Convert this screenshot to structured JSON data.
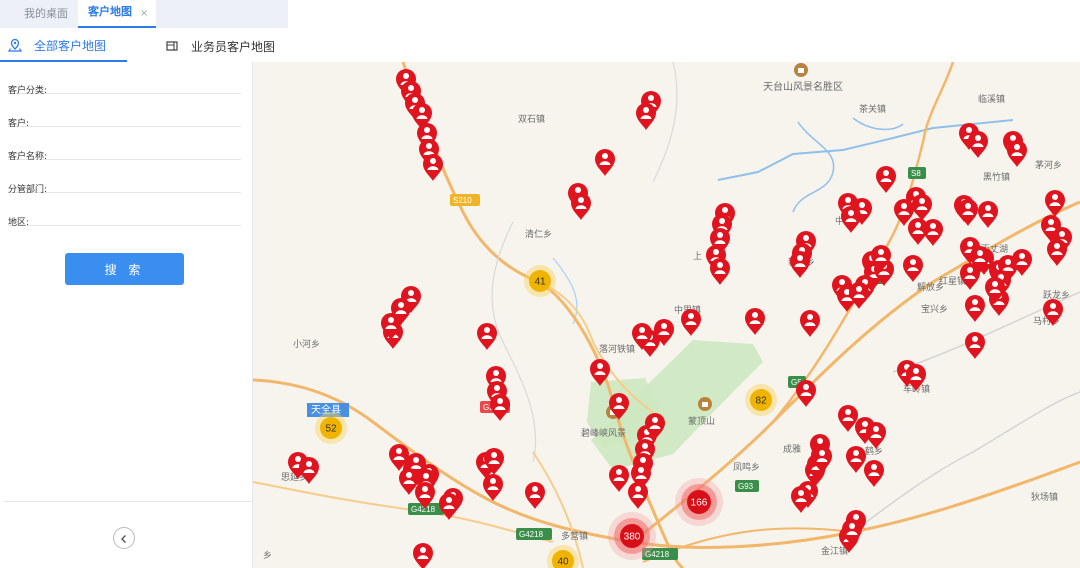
{
  "tabs": [
    {
      "label": "我的桌面"
    },
    {
      "label": "客户地图",
      "close": "×"
    }
  ],
  "subtabs": [
    {
      "label": "全部客户地图"
    },
    {
      "label": "业务员客户地图"
    }
  ],
  "filters": [
    {
      "label": "客户分类:"
    },
    {
      "label": "客户:"
    },
    {
      "label": "客户名称:"
    },
    {
      "label": "分管部门:"
    },
    {
      "label": "地区:"
    }
  ],
  "search_label": "搜 索",
  "map": {
    "places": [
      {
        "t": "天台山风景名胜区"
      },
      {
        "t": "双石镇"
      },
      {
        "t": "清仁乡"
      },
      {
        "t": "小河乡"
      },
      {
        "t": "上"
      },
      {
        "t": "中里镇"
      },
      {
        "t": "中峰"
      },
      {
        "t": "新县乡"
      },
      {
        "t": "落河铁镇"
      },
      {
        "t": "蒙顶山"
      },
      {
        "t": "碧峰峡风景"
      },
      {
        "t": "凤鸣乡"
      },
      {
        "t": "多营镇"
      },
      {
        "t": "金江镇"
      },
      {
        "t": "狄场镇"
      },
      {
        "t": "思延乡"
      },
      {
        "t": "鹤乡"
      },
      {
        "t": "红星镇"
      },
      {
        "t": "黑竹镇"
      },
      {
        "t": "茅河乡"
      },
      {
        "t": "马村乡"
      },
      {
        "t": "跃龙乡"
      },
      {
        "t": "解放乡"
      },
      {
        "t": "车岭镇"
      },
      {
        "t": "成雅"
      },
      {
        "t": "百丈湖"
      },
      {
        "t": "茶关镇"
      },
      {
        "t": "临溪镇"
      },
      {
        "t": "乡"
      },
      {
        "t": "天全县"
      },
      {
        "t": "宝兴乡"
      }
    ],
    "roads": [
      {
        "t": "S210"
      },
      {
        "t": "S8"
      },
      {
        "t": "G5"
      },
      {
        "t": "G5"
      },
      {
        "t": "G4218"
      },
      {
        "t": "G4218"
      },
      {
        "t": "G4218"
      },
      {
        "t": "G93"
      },
      {
        "t": "G351"
      }
    ],
    "clusters": [
      {
        "n": "41",
        "kind": "yellow"
      },
      {
        "n": "52",
        "kind": "yellow"
      },
      {
        "n": "82",
        "kind": "yellow"
      },
      {
        "n": "40",
        "kind": "yellow"
      },
      {
        "n": "166",
        "kind": "red"
      },
      {
        "n": "380",
        "kind": "red"
      }
    ]
  }
}
